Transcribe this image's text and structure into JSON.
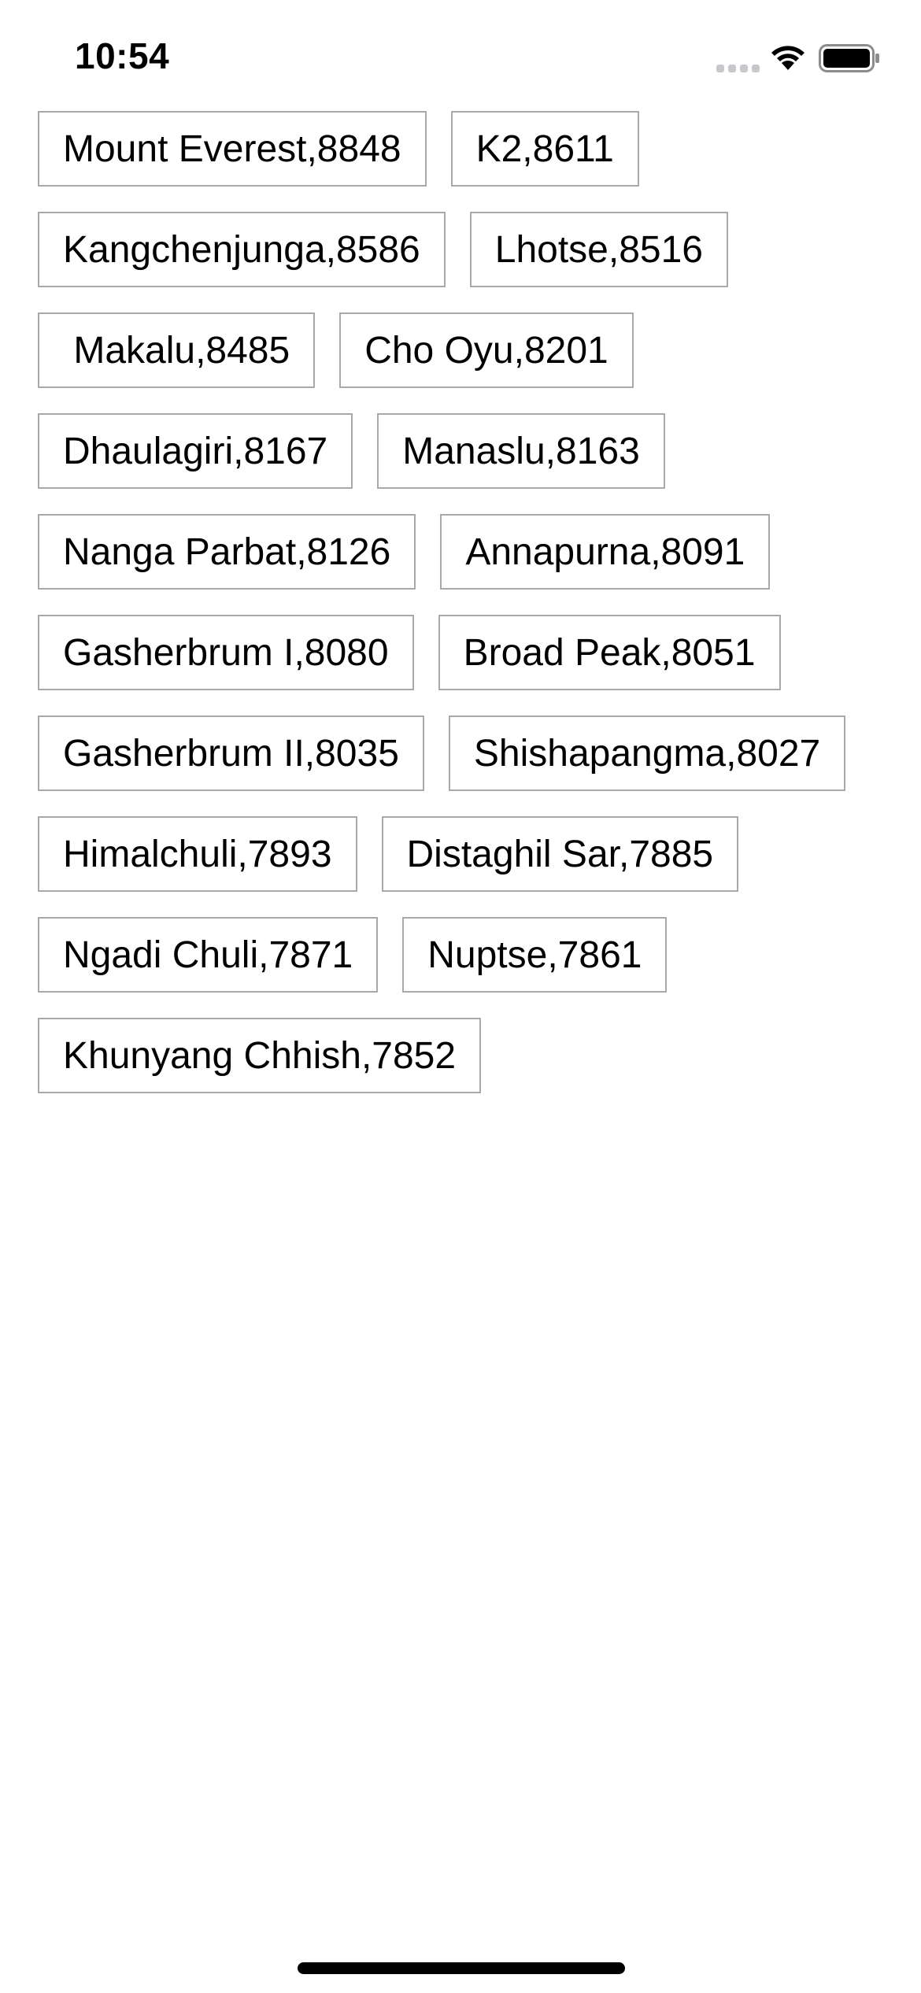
{
  "status_bar": {
    "time": "10:54",
    "icons": [
      "cellular-signal-icon",
      "wifi-icon",
      "battery-icon"
    ]
  },
  "mountains": [
    {
      "label": "Mount Everest,8848"
    },
    {
      "label": "K2,8611"
    },
    {
      "label": "Kangchenjunga,8586"
    },
    {
      "label": "Lhotse,8516"
    },
    {
      "label": " Makalu,8485"
    },
    {
      "label": "Cho Oyu,8201"
    },
    {
      "label": "Dhaulagiri,8167"
    },
    {
      "label": "Manaslu,8163"
    },
    {
      "label": "Nanga Parbat,8126"
    },
    {
      "label": "Annapurna,8091"
    },
    {
      "label": "Gasherbrum I,8080"
    },
    {
      "label": "Broad Peak,8051"
    },
    {
      "label": "Gasherbrum II,8035"
    },
    {
      "label": "Shishapangma,8027"
    },
    {
      "label": "Himalchuli,7893"
    },
    {
      "label": "Distaghil Sar,7885"
    },
    {
      "label": "Ngadi Chuli,7871"
    },
    {
      "label": "Nuptse,7861"
    },
    {
      "label": "Khunyang Chhish,7852"
    }
  ],
  "colors": {
    "tag_border": "#a9a9a9",
    "text": "#000000",
    "background": "#ffffff"
  }
}
